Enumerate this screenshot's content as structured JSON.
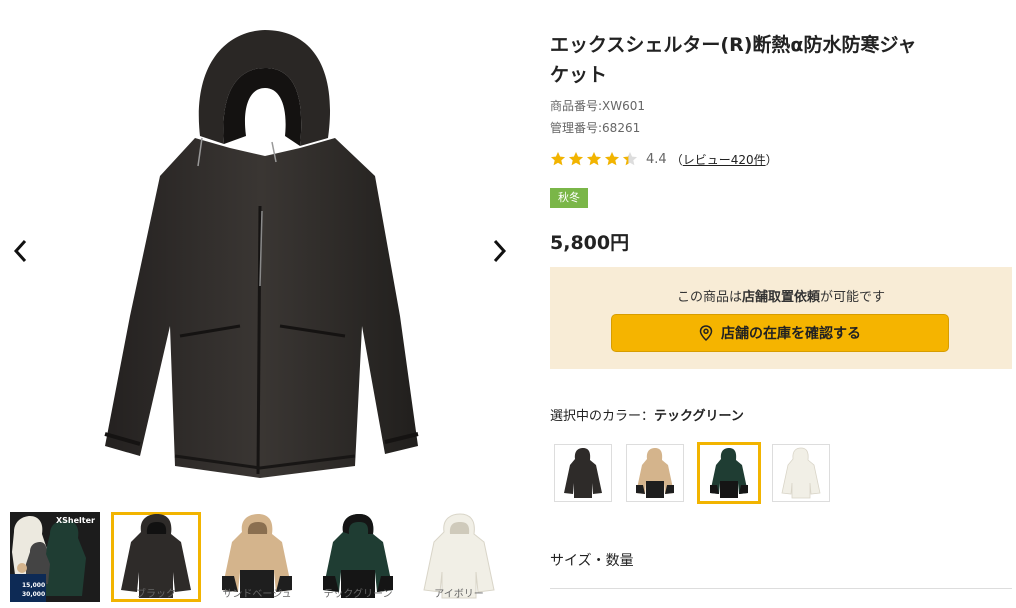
{
  "product": {
    "title": "エックスシェルター(R)断熱α防水防寒ジャケット",
    "product_number": "商品番号:XW601",
    "management_number": "管理番号:68261",
    "rating": "4.4",
    "review_prefix": "（",
    "review_link": "レビュー420件",
    "review_suffix": "）",
    "rating_stars": 4.4,
    "season_badge": "秋冬",
    "price": "5,800円"
  },
  "pickup": {
    "text_before": "この商品は",
    "text_bold": "店舗取置依頼",
    "text_after": "が可能です",
    "button_label": "店舗の在庫を確認する",
    "button_icon": "map-pin-icon"
  },
  "color_selection": {
    "heading_prefix": "選択中のカラー：",
    "selected_color": "テックグリーン",
    "swatches": [
      {
        "name": "ブラック",
        "body": "#2e2b29",
        "lower": "#2e2b29"
      },
      {
        "name": "サンドベージュ",
        "body": "#d4b48c",
        "lower": "#1e1e1e"
      },
      {
        "name": "テックグリーン",
        "body": "#1f3d33",
        "lower": "#151515"
      },
      {
        "name": "アイボリー",
        "body": "#f1efe6",
        "lower": "#e6e2d6"
      }
    ]
  },
  "gallery": {
    "prev_icon": "chevron-left-icon",
    "next_icon": "chevron-right-icon",
    "thumbs": [
      {
        "label": "",
        "brand": "XShelter",
        "spec1": "15,000",
        "spec2": "30,000"
      },
      {
        "label": "ブラック"
      },
      {
        "label": "サンドベージュ"
      },
      {
        "label": "テックグリーン"
      },
      {
        "label": "アイボリー"
      }
    ]
  },
  "size_quantity": {
    "label": "サイズ・数量"
  },
  "colors": {
    "accent": "#f5b400",
    "badge": "#7ab648",
    "pickup_bg": "#f8ecd6",
    "star": "#f2b400"
  }
}
